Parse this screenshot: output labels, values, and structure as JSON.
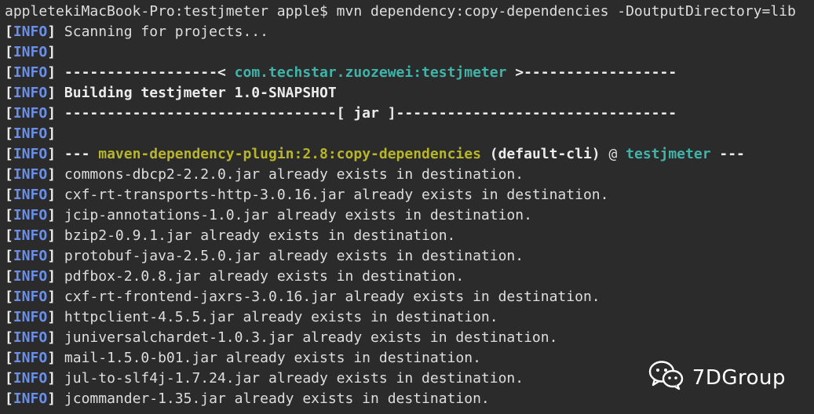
{
  "colors": {
    "background": "#2b2b2b",
    "text": "#dedede",
    "info_tag": "#6b8fe6",
    "project_teal": "#3fb5aa",
    "plugin_yellow": "#b7b52a",
    "bold_white": "#ececec"
  },
  "terminal": {
    "prompt": "appletekiMacBook-Pro:testjmeter apple$ mvn dependency:copy-dependencies -DoutputDirectory=lib",
    "lines": [
      {
        "tag": "INFO",
        "segments": [
          {
            "text": "Scanning for projects...",
            "style": "plain"
          }
        ]
      },
      {
        "tag": "INFO",
        "segments": []
      },
      {
        "tag": "INFO",
        "segments": [
          {
            "text": "------------------< ",
            "style": "bold"
          },
          {
            "text": "com.techstar.zuozewei:testjmeter",
            "style": "teal"
          },
          {
            "text": " >------------------",
            "style": "bold"
          }
        ]
      },
      {
        "tag": "INFO",
        "segments": [
          {
            "text": "Building testjmeter 1.0-SNAPSHOT",
            "style": "bold"
          }
        ]
      },
      {
        "tag": "INFO",
        "segments": [
          {
            "text": "--------------------------------[ jar ]---------------------------------",
            "style": "bold"
          }
        ]
      },
      {
        "tag": "INFO",
        "segments": []
      },
      {
        "tag": "INFO",
        "segments": [
          {
            "text": "--- ",
            "style": "bold"
          },
          {
            "text": "maven-dependency-plugin:2.8:copy-dependencies",
            "style": "yellow"
          },
          {
            "text": " (default-cli)",
            "style": "bold"
          },
          {
            "text": " @ ",
            "style": "plain"
          },
          {
            "text": "testjmeter",
            "style": "teal"
          },
          {
            "text": " ---",
            "style": "bold"
          }
        ]
      },
      {
        "tag": "INFO",
        "segments": [
          {
            "text": "commons-dbcp2-2.2.0.jar already exists in destination.",
            "style": "plain"
          }
        ]
      },
      {
        "tag": "INFO",
        "segments": [
          {
            "text": "cxf-rt-transports-http-3.0.16.jar already exists in destination.",
            "style": "plain"
          }
        ]
      },
      {
        "tag": "INFO",
        "segments": [
          {
            "text": "jcip-annotations-1.0.jar already exists in destination.",
            "style": "plain"
          }
        ]
      },
      {
        "tag": "INFO",
        "segments": [
          {
            "text": "bzip2-0.9.1.jar already exists in destination.",
            "style": "plain"
          }
        ]
      },
      {
        "tag": "INFO",
        "segments": [
          {
            "text": "protobuf-java-2.5.0.jar already exists in destination.",
            "style": "plain"
          }
        ]
      },
      {
        "tag": "INFO",
        "segments": [
          {
            "text": "pdfbox-2.0.8.jar already exists in destination.",
            "style": "plain"
          }
        ]
      },
      {
        "tag": "INFO",
        "segments": [
          {
            "text": "cxf-rt-frontend-jaxrs-3.0.16.jar already exists in destination.",
            "style": "plain"
          }
        ]
      },
      {
        "tag": "INFO",
        "segments": [
          {
            "text": "httpclient-4.5.5.jar already exists in destination.",
            "style": "plain"
          }
        ]
      },
      {
        "tag": "INFO",
        "segments": [
          {
            "text": "juniversalchardet-1.0.3.jar already exists in destination.",
            "style": "plain"
          }
        ]
      },
      {
        "tag": "INFO",
        "segments": [
          {
            "text": "mail-1.5.0-b01.jar already exists in destination.",
            "style": "plain"
          }
        ]
      },
      {
        "tag": "INFO",
        "segments": [
          {
            "text": "jul-to-slf4j-1.7.24.jar already exists in destination.",
            "style": "plain"
          }
        ]
      },
      {
        "tag": "INFO",
        "segments": [
          {
            "text": "jcommander-1.35.jar already exists in destination.",
            "style": "plain"
          }
        ]
      }
    ]
  },
  "watermark": {
    "icon": "wechat-icon",
    "text": "7DGroup"
  }
}
